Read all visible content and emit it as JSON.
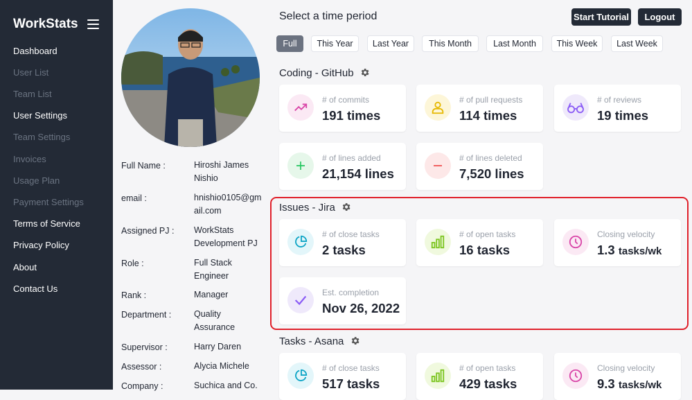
{
  "app": {
    "name": "WorkStats"
  },
  "sidebar": {
    "items": [
      {
        "label": "Dashboard"
      },
      {
        "label": "User List"
      },
      {
        "label": "Team List"
      },
      {
        "label": "User Settings"
      },
      {
        "label": "Team Settings"
      },
      {
        "label": "Invoices"
      },
      {
        "label": "Usage Plan"
      },
      {
        "label": "Payment Settings"
      },
      {
        "label": "Terms of Service"
      },
      {
        "label": "Privacy Policy"
      },
      {
        "label": "About"
      },
      {
        "label": "Contact Us"
      }
    ]
  },
  "profile": {
    "fields": [
      {
        "label": "Full Name :",
        "value": "Hiroshi James Nishio"
      },
      {
        "label": "email :",
        "value": "hnishio0105@gmail.com"
      },
      {
        "label": "Assigned PJ :",
        "value": "WorkStats Development PJ"
      },
      {
        "label": "Role :",
        "value": "Full Stack Engineer"
      },
      {
        "label": "Rank :",
        "value": "Manager"
      },
      {
        "label": "Department :",
        "value": "Quality Assurance"
      },
      {
        "label": "Supervisor :",
        "value": "Harry Daren"
      },
      {
        "label": "Assessor :",
        "value": "Alycia Michele"
      },
      {
        "label": "Company :",
        "value": "Suchica and Co."
      }
    ]
  },
  "header": {
    "title": "Select a time period",
    "tutorial_label": "Start Tutorial",
    "logout_label": "Logout"
  },
  "periods": [
    "Full",
    "This Year",
    "Last Year",
    "This Month",
    "Last Month",
    "This Week",
    "Last Week"
  ],
  "selected_period": "Full",
  "sections": {
    "github": {
      "title": "Coding - GitHub",
      "cards": [
        {
          "label": "# of commits",
          "value": "191 times",
          "icon": "trending-up-icon"
        },
        {
          "label": "# of pull requests",
          "value": "114 times",
          "icon": "user-icon"
        },
        {
          "label": "# of reviews",
          "value": "19 times",
          "icon": "glasses-icon"
        },
        {
          "label": "# of lines added",
          "value": "21,154 lines",
          "icon": "plus-icon"
        },
        {
          "label": "# of lines deleted",
          "value": "7,520 lines",
          "icon": "minus-icon"
        }
      ]
    },
    "jira": {
      "title": "Issues - Jira",
      "cards": [
        {
          "label": "# of close tasks",
          "value": "2 tasks",
          "icon": "pie-chart-icon"
        },
        {
          "label": "# of open tasks",
          "value": "16 tasks",
          "icon": "bar-chart-icon"
        },
        {
          "label": "Closing velocity",
          "value_num": "1.3",
          "value_unit": "tasks/wk",
          "icon": "clock-icon"
        },
        {
          "label": "Est. completion",
          "value": "Nov 26, 2022",
          "icon": "check-icon"
        }
      ]
    },
    "asana": {
      "title": "Tasks - Asana",
      "cards": [
        {
          "label": "# of close tasks",
          "value": "517 tasks",
          "icon": "pie-chart-icon"
        },
        {
          "label": "# of open tasks",
          "value": "429 tasks",
          "icon": "bar-chart-icon"
        },
        {
          "label": "Closing velocity",
          "value_num": "9.3",
          "value_unit": "tasks/wk",
          "icon": "clock-icon"
        }
      ]
    }
  },
  "colors": {
    "sidebar_bg": "#232a36",
    "highlight_border": "#e0202a",
    "pink_icon": "#d946a8",
    "yellow_icon": "#e6b800",
    "purple_icon": "#8b5cf6",
    "green_icon": "#22c55e",
    "red_icon": "#ef4444",
    "cyan_icon": "#0ea5c6",
    "lime_icon": "#7cc520"
  }
}
